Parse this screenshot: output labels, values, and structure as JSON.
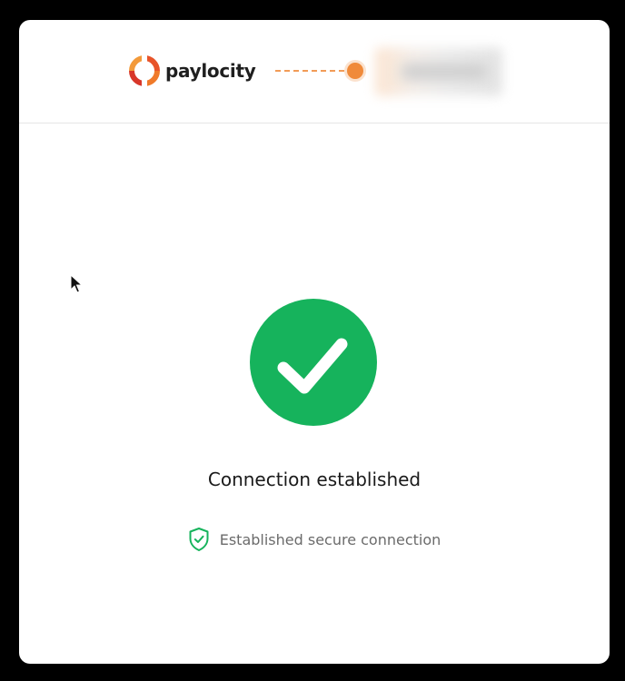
{
  "brand": {
    "name": "paylocity",
    "logo_icon": "paylocity-logo-icon",
    "logo_color": "#e8542a"
  },
  "connector": {
    "color": "#f08a3a"
  },
  "status": {
    "title": "Connection established",
    "success_icon": "checkmark-icon",
    "success_color": "#16b35c"
  },
  "security": {
    "text": "Established secure connection",
    "icon": "shield-check-icon",
    "icon_color": "#16b35c"
  },
  "colors": {
    "background": "#000000",
    "card": "#ffffff",
    "divider": "#e6e6e6"
  }
}
